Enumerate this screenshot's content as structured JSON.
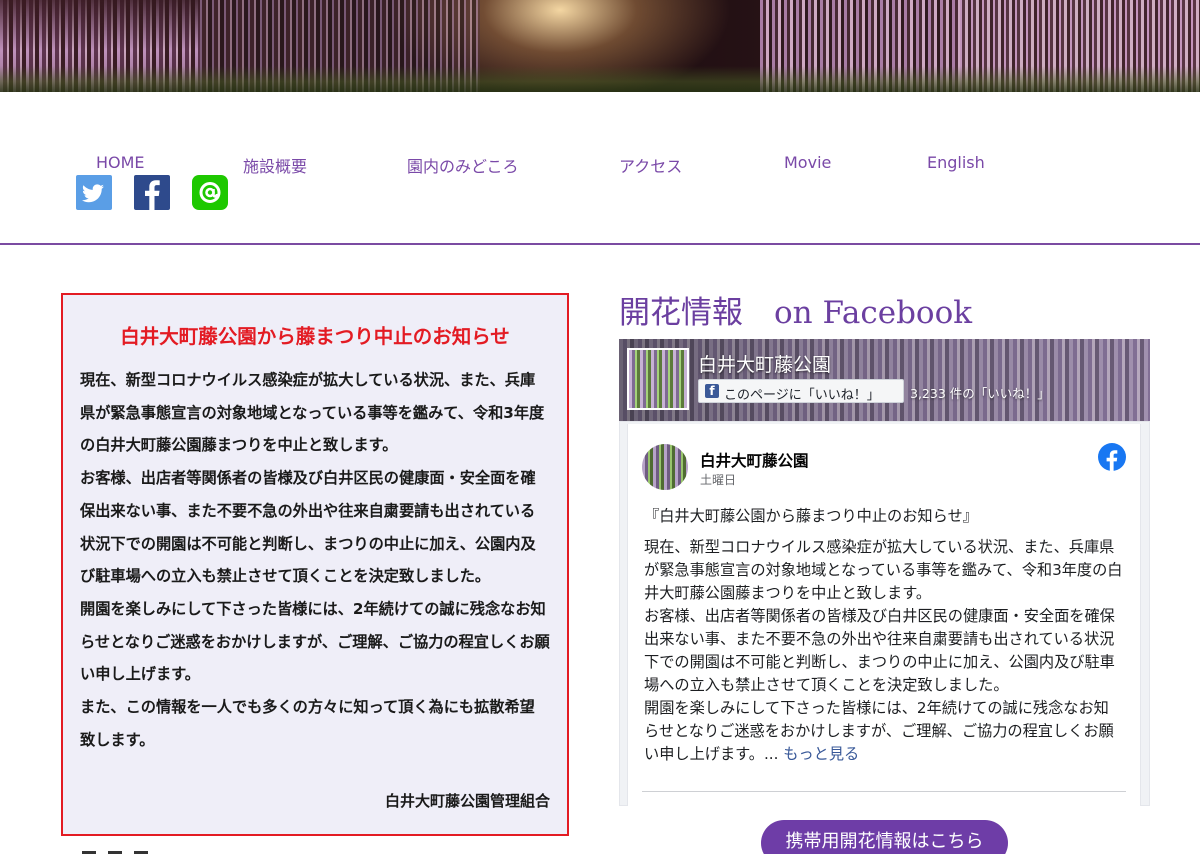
{
  "nav": {
    "items": [
      "HOME",
      "施設概要",
      "園内のみどころ",
      "アクセス",
      "Movie",
      "English"
    ]
  },
  "social": {
    "icons": [
      "twitter-icon",
      "facebook-icon",
      "line-icon"
    ],
    "colors": {
      "twitter": "#5a9ee6",
      "facebook": "#2e4a8c",
      "line": "#1ec800"
    }
  },
  "notice": {
    "title": "白井大町藤公園から藤まつり中止のお知らせ",
    "paragraphs": [
      "現在、新型コロナウイルス感染症が拡大している状況、また、兵庫県が緊急事態宣言の対象地域となっている事等を鑑みて、令和3年度の白井大町藤公園藤まつりを中止と致します。",
      "お客様、出店者等関係者の皆様及び白井区民の健康面・安全面を確保出来ない事、また不要不急の外出や往来自粛要請も出されている状況下での開園は不可能と判断し、まつりの中止に加え、公園内及び駐車場への立入も禁止させて頂くことを決定致しました。",
      "開園を楽しみにして下さった皆様には、2年続けての誠に残念なお知らせとなりご迷惑をおかけしますが、ご理解、ご協力の程宜しくお願い申し上げます。",
      "また、この情報を一人でも多くの方々に知って頂く為にも拡散希望致します。"
    ],
    "signature": "白井大町藤公園管理組合",
    "colors": {
      "border": "#e31b23",
      "background": "#efeef8",
      "title": "#e31b23"
    }
  },
  "facebook": {
    "heading": "開花情報　on Facebook",
    "page_name": "白井大町藤公園",
    "like_button": "このページに「いいね！」",
    "like_count": "3,233 件の「いいね！」",
    "post": {
      "author": "白井大町藤公園",
      "date": "土曜日",
      "title_line": "『白井大町藤公園から藤まつり中止のお知らせ』",
      "paragraphs": [
        "現在、新型コロナウイルス感染症が拡大している状況、また、兵庫県が緊急事態宣言の対象地域となっている事等を鑑みて、令和3年度の白井大町藤公園藤まつりを中止と致します。",
        "お客様、出店者等関係者の皆様及び白井区民の健康面・安全面を確保出来ない事、また不要不急の外出や往来自粛要請も出されている状況下での開園は不可能と判断し、まつりの中止に加え、公園内及び駐車場への立入も禁止させて頂くことを決定致しました。",
        "開園を楽しみにして下さった皆様には、2年続けての誠に残念なお知らせとなりご迷惑をおかけしますが、ご理解、ご協力の程宜しくお願い申し上げます。..."
      ],
      "see_more": "もっと見る"
    }
  },
  "mobile_button": "携帯用開花情報はこちら",
  "colors": {
    "accent": "#7b4ba2",
    "nav_text": "#7a49a8",
    "button": "#6e3da7",
    "fb_link": "#385898"
  }
}
